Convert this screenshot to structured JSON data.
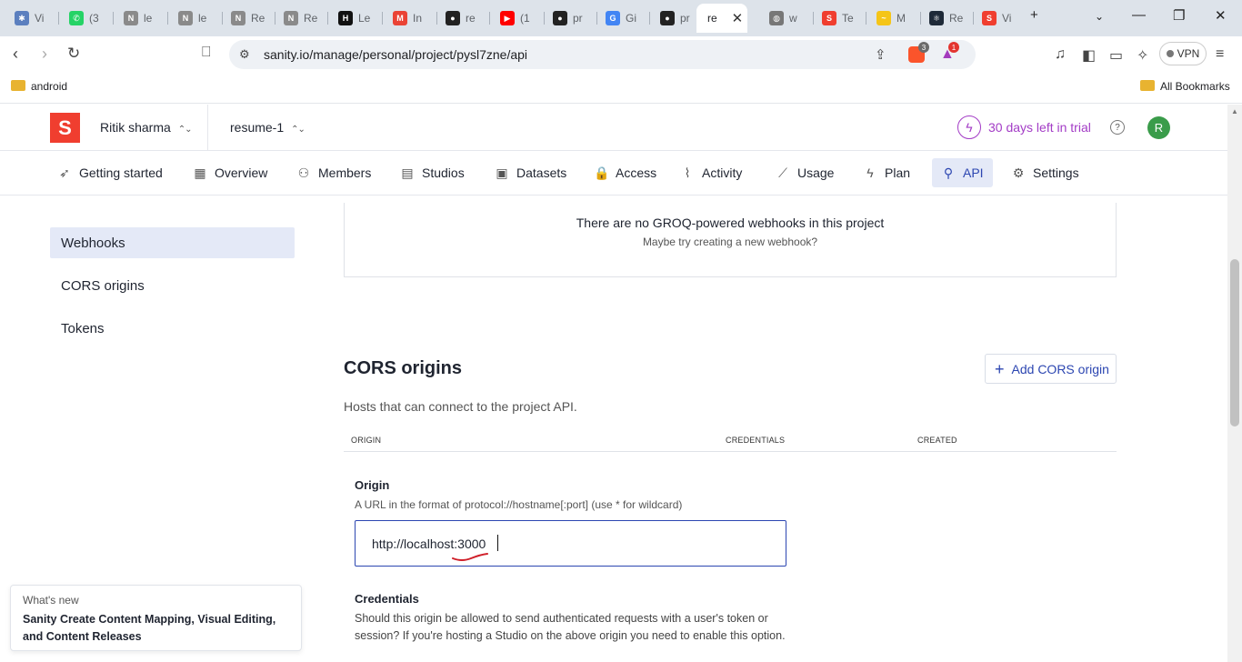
{
  "browser": {
    "tabs": [
      {
        "label": "Vi",
        "color": "#5b7fbf",
        "glyph": "✱"
      },
      {
        "label": "(3",
        "color": "#25d366",
        "glyph": "✆"
      },
      {
        "label": "le",
        "color": "#8a8a8a",
        "glyph": "N"
      },
      {
        "label": "le",
        "color": "#8a8a8a",
        "glyph": "N"
      },
      {
        "label": "Re",
        "color": "#8a8a8a",
        "glyph": "N"
      },
      {
        "label": "Re",
        "color": "#8a8a8a",
        "glyph": "N"
      },
      {
        "label": "Le",
        "color": "#111111",
        "glyph": "H"
      },
      {
        "label": "In",
        "color": "#ea4335",
        "glyph": "M"
      },
      {
        "label": "re",
        "color": "#222222",
        "glyph": "●"
      },
      {
        "label": "(1",
        "color": "#ff0000",
        "glyph": "▶"
      },
      {
        "label": "pr",
        "color": "#222222",
        "glyph": "●"
      },
      {
        "label": "Gi",
        "color": "#4285f4",
        "glyph": "G"
      },
      {
        "label": "pr",
        "color": "#222222",
        "glyph": "●"
      },
      {
        "label": "re",
        "color": "#ffffff",
        "glyph": ""
      },
      {
        "label": "w",
        "color": "#777777",
        "glyph": "◍"
      },
      {
        "label": "Te",
        "color": "#f03e2f",
        "glyph": "S"
      },
      {
        "label": "M",
        "color": "#f5c518",
        "glyph": "~"
      },
      {
        "label": "Re",
        "color": "#1e2a38",
        "glyph": "⚛"
      },
      {
        "label": "Vi",
        "color": "#f03e2f",
        "glyph": "S"
      }
    ],
    "active_tab_close": "✕",
    "new_tab": "+",
    "url": "sanity.io/manage/personal/project/pysl7zne/api",
    "brave_badge": "3",
    "alert_badge": "1",
    "vpn_label": "VPN",
    "bookmarks": {
      "left": "android",
      "right": "All Bookmarks"
    }
  },
  "app": {
    "logo_letter": "S",
    "org_name": "Ritik sharma",
    "project_name": "resume-1",
    "trial_text": "30 days left in trial",
    "avatar_initial": "R",
    "nav": [
      {
        "label": "Getting started",
        "icon": "rocket-icon",
        "glyph": "➶"
      },
      {
        "label": "Overview",
        "icon": "layout-icon",
        "glyph": "▦"
      },
      {
        "label": "Members",
        "icon": "users-icon",
        "glyph": "⚇"
      },
      {
        "label": "Studios",
        "icon": "studios-icon",
        "glyph": "▤"
      },
      {
        "label": "Datasets",
        "icon": "database-icon",
        "glyph": "▣"
      },
      {
        "label": "Access",
        "icon": "lock-icon",
        "glyph": "🔒"
      },
      {
        "label": "Activity",
        "icon": "activity-icon",
        "glyph": "⌇"
      },
      {
        "label": "Usage",
        "icon": "chart-icon",
        "glyph": "⟋"
      },
      {
        "label": "Plan",
        "icon": "bolt-icon",
        "glyph": "ϟ"
      },
      {
        "label": "API",
        "icon": "plug-icon",
        "glyph": "⚲"
      },
      {
        "label": "Settings",
        "icon": "gear-icon",
        "glyph": "⚙"
      }
    ],
    "active_nav": "API",
    "sidebar": [
      {
        "label": "Webhooks"
      },
      {
        "label": "CORS origins"
      },
      {
        "label": "Tokens"
      }
    ],
    "webhooks": {
      "empty_title": "There are no GROQ-powered webhooks in this project",
      "empty_hint": "Maybe try creating a new webhook?"
    },
    "cors": {
      "title": "CORS origins",
      "add_button": "Add CORS origin",
      "subtitle": "Hosts that can connect to the project API.",
      "columns": [
        "ORIGIN",
        "CREDENTIALS",
        "CREATED"
      ],
      "origin_label": "Origin",
      "origin_help": "A URL in the format of protocol://hostname[:port] (use * for wildcard)",
      "origin_value": "http://localhost:3000",
      "credentials_label": "Credentials",
      "credentials_help": "Should this origin be allowed to send authenticated requests with a user's token or session? If you're hosting a Studio on the above origin you need to enable this option."
    },
    "whats_new": {
      "kicker": "What's new",
      "headline": "Sanity Create Content Mapping, Visual Editing, and Content Releases"
    }
  },
  "colors": {
    "accent": "#2c46b1",
    "brand": "#f03e2f",
    "trial": "#a33cc6"
  }
}
